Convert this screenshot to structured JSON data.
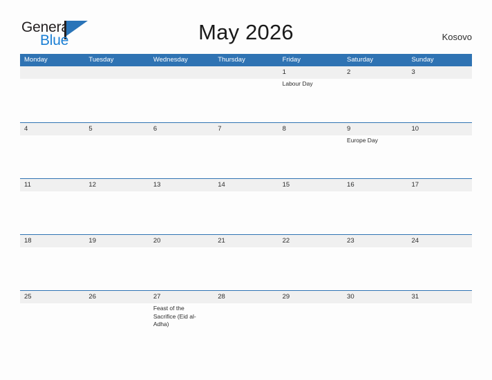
{
  "brand": {
    "name_top": "General",
    "name_bottom": "Blue",
    "flag_icon": "triangle-flag-icon",
    "colors": {
      "general_text": "#231f20",
      "blue_text": "#1b7fd4",
      "flag": "#2a74b8"
    }
  },
  "header": {
    "title": "May 2026",
    "country": "Kosovo"
  },
  "theme": {
    "header_blue": "#2f73b3",
    "row_band_gray": "#f0f0f0",
    "row_rule": "#2f73b3",
    "page_background": "#fdfdfd",
    "text": "#2b2b2b"
  },
  "calendar": {
    "weekdays": [
      "Monday",
      "Tuesday",
      "Wednesday",
      "Thursday",
      "Friday",
      "Saturday",
      "Sunday"
    ],
    "weeks": [
      [
        {
          "day": "",
          "events": []
        },
        {
          "day": "",
          "events": []
        },
        {
          "day": "",
          "events": []
        },
        {
          "day": "",
          "events": []
        },
        {
          "day": "1",
          "events": [
            "Labour Day"
          ]
        },
        {
          "day": "2",
          "events": []
        },
        {
          "day": "3",
          "events": []
        }
      ],
      [
        {
          "day": "4",
          "events": []
        },
        {
          "day": "5",
          "events": []
        },
        {
          "day": "6",
          "events": []
        },
        {
          "day": "7",
          "events": []
        },
        {
          "day": "8",
          "events": []
        },
        {
          "day": "9",
          "events": [
            "Europe Day"
          ]
        },
        {
          "day": "10",
          "events": []
        }
      ],
      [
        {
          "day": "11",
          "events": []
        },
        {
          "day": "12",
          "events": []
        },
        {
          "day": "13",
          "events": []
        },
        {
          "day": "14",
          "events": []
        },
        {
          "day": "15",
          "events": []
        },
        {
          "day": "16",
          "events": []
        },
        {
          "day": "17",
          "events": []
        }
      ],
      [
        {
          "day": "18",
          "events": []
        },
        {
          "day": "19",
          "events": []
        },
        {
          "day": "20",
          "events": []
        },
        {
          "day": "21",
          "events": []
        },
        {
          "day": "22",
          "events": []
        },
        {
          "day": "23",
          "events": []
        },
        {
          "day": "24",
          "events": []
        }
      ],
      [
        {
          "day": "25",
          "events": []
        },
        {
          "day": "26",
          "events": []
        },
        {
          "day": "27",
          "events": [
            "Feast of the Sacrifice (Eid al-Adha)"
          ]
        },
        {
          "day": "28",
          "events": []
        },
        {
          "day": "29",
          "events": []
        },
        {
          "day": "30",
          "events": []
        },
        {
          "day": "31",
          "events": []
        }
      ]
    ]
  }
}
